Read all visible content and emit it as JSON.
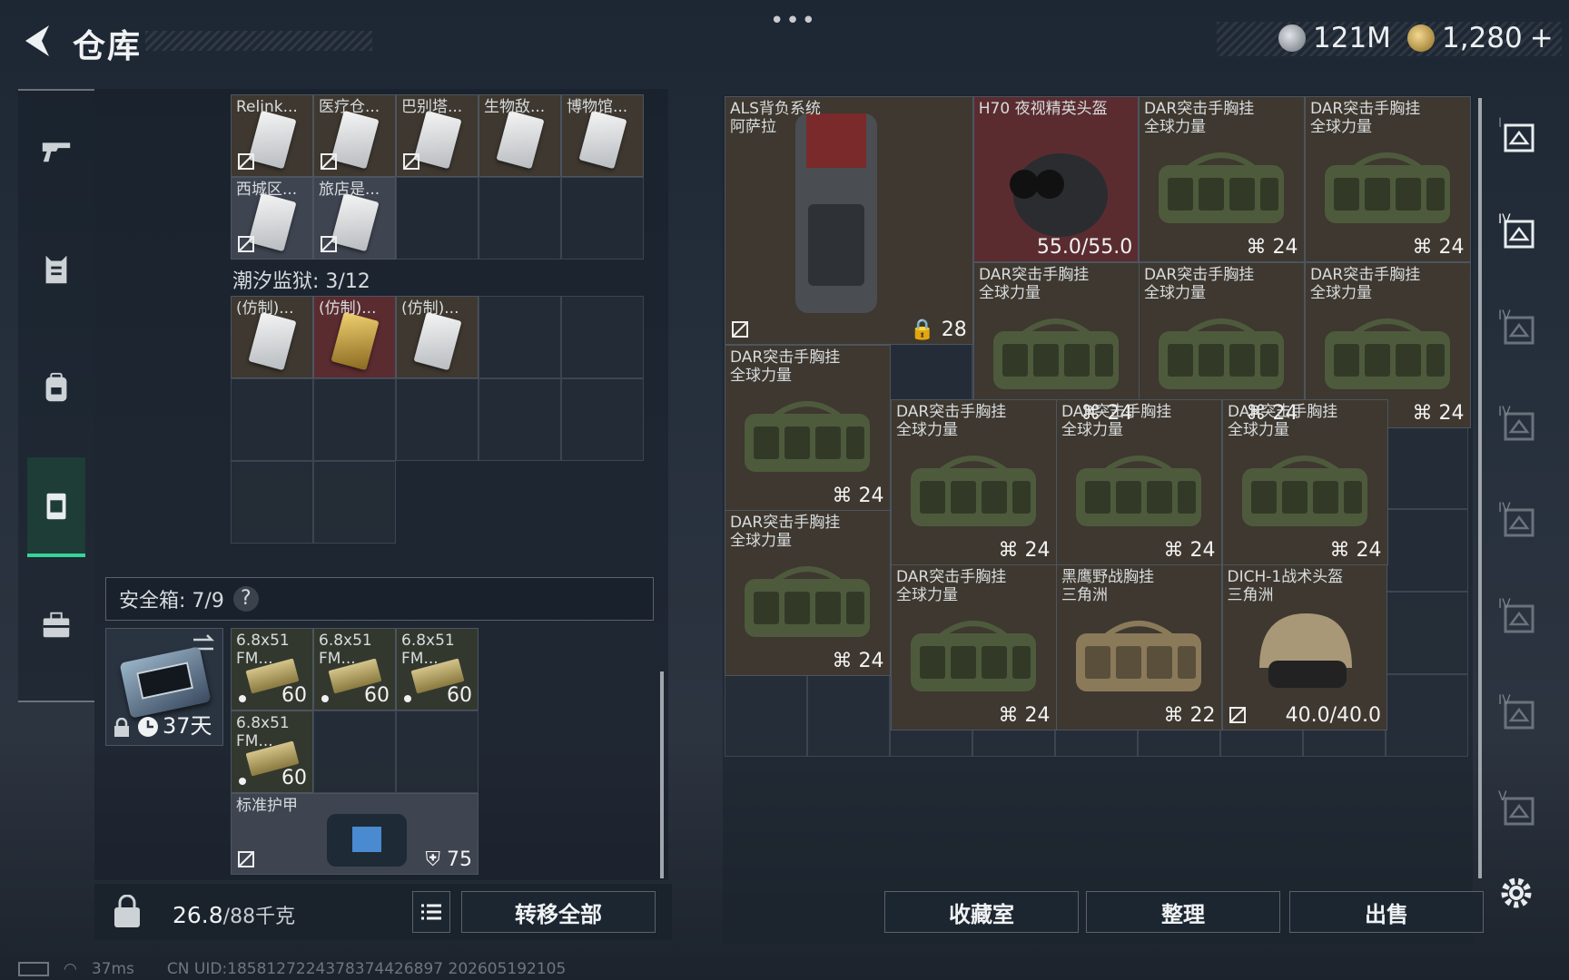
{
  "header": {
    "title": "仓库",
    "menu_dots": "•••",
    "currency": [
      {
        "icon": "silver-coin-icon",
        "amount": "121M",
        "color": "#b0b4b8"
      },
      {
        "icon": "gold-coin-icon",
        "amount": "1,280",
        "color": "#d4b060",
        "plus": "+"
      }
    ]
  },
  "left_nav": [
    {
      "icon": "gun-icon"
    },
    {
      "icon": "armor-vest-icon"
    },
    {
      "icon": "backpack-icon"
    },
    {
      "icon": "container-icon",
      "active": true
    },
    {
      "icon": "briefcase-icon"
    }
  ],
  "keys_panel": {
    "row1": [
      "Relink...",
      "医疗仓...",
      "巴别塔...",
      "生物敌...",
      "博物馆..."
    ],
    "row2": [
      "西城区...",
      "旅店是..."
    ],
    "section_label": "潮汐监狱: 3/12",
    "copies": [
      "(仿制)...",
      "(仿制)...",
      "(仿制)..."
    ]
  },
  "safebox": {
    "label": "安全箱: 7/9",
    "help": "?",
    "time": "37天",
    "ammo": [
      {
        "name": "6.8x51\nFM...",
        "count": "60"
      },
      {
        "name": "6.8x51\nFM...",
        "count": "60"
      },
      {
        "name": "6.8x51\nFM...",
        "count": "60"
      },
      {
        "name": "6.8x51\nFM...",
        "count": "60"
      }
    ],
    "armor": {
      "name": "标准护甲",
      "value": "75"
    }
  },
  "weight": {
    "current": "26.8",
    "max": "/88千克"
  },
  "transfer_all": "转移全部",
  "stash": {
    "backpack": {
      "name": "ALS背负系统\n阿萨拉",
      "value": "28"
    },
    "nvg": {
      "name": "H70 夜视精英头盔",
      "value": "55.0/55.0"
    },
    "rig_name": "DAR突击手胸挂\n全球力量",
    "rig_value": "24",
    "hawk": {
      "name": "黑鹰野战胸挂\n三角洲",
      "value": "22"
    },
    "helmet": {
      "name": "DICH-1战术头盔\n三角洲",
      "value": "40.0/40.0"
    }
  },
  "buttons": {
    "collection": "收藏室",
    "sort": "整理",
    "sell": "出售"
  },
  "status_bar": {
    "ping": "37ms",
    "uid": "CN UID:1858127224378374426897 202605192105"
  },
  "right_tabs": [
    "I",
    "IV",
    "IV",
    "IV",
    "IV",
    "IV",
    "IV",
    "V"
  ],
  "colors": {
    "accent": "#38d39a"
  }
}
